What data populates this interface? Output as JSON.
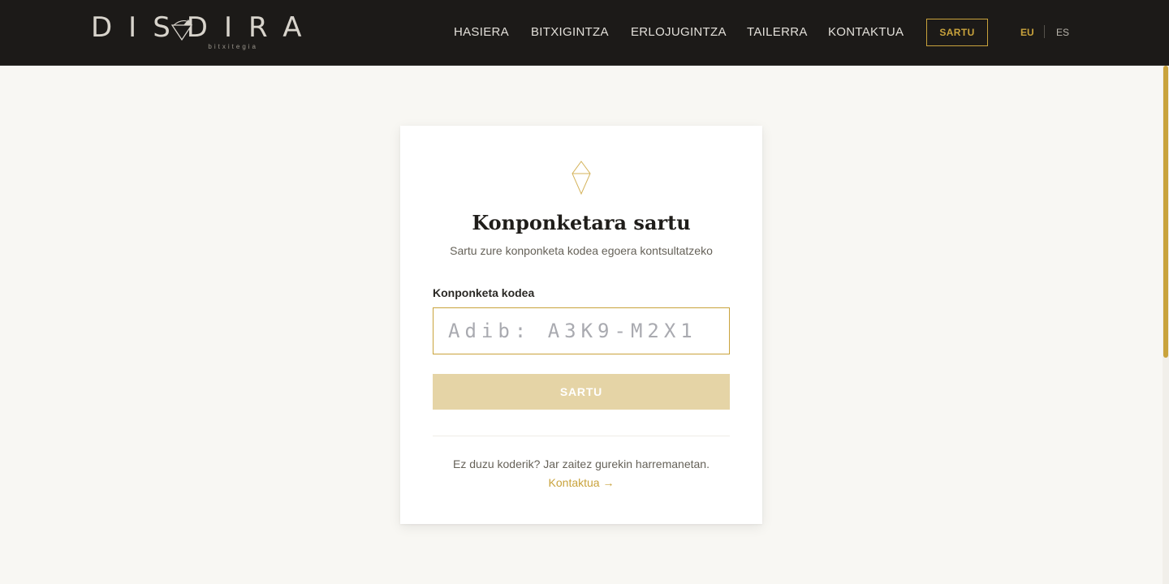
{
  "header": {
    "logo_text": "DISDIRA",
    "logo_subtext": "bitxitegia",
    "nav": [
      {
        "label": "HASIERA"
      },
      {
        "label": "BITXIGINTZA"
      },
      {
        "label": "ERLOJUGINTZA"
      },
      {
        "label": "TAILERRA"
      },
      {
        "label": "KONTAKTUA"
      }
    ],
    "login_label": "SARTU",
    "languages": [
      {
        "code": "EU",
        "active": true
      },
      {
        "code": "ES",
        "active": false
      }
    ]
  },
  "card": {
    "icon": "diamond-icon",
    "title": "Konponketara sartu",
    "subtitle": "Sartu zure konponketa kodea egoera kontsultatzeko",
    "field_label": "Konponketa kodea",
    "field_placeholder": "Adib: A3K9-M2X1",
    "field_value": "",
    "submit_label": "SARTU",
    "help_text": "Ez duzu koderik? Jar zaitez gurekin harremanetan.",
    "contact_label": "Kontaktua →"
  },
  "colors": {
    "header_bg": "#1c1a18",
    "accent": "#c9a33c",
    "page_bg": "#f8f7f3",
    "button_disabled": "#e5d4a6"
  }
}
